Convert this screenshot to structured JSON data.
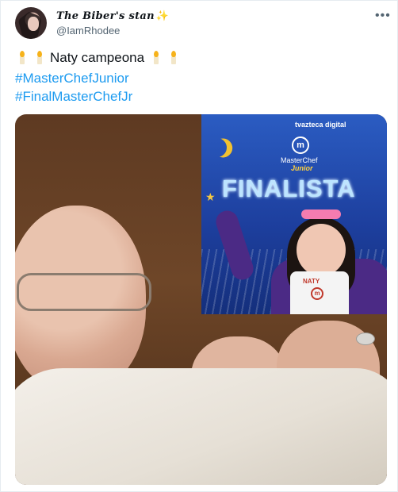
{
  "tweet": {
    "display_name": "The Biber's stan",
    "display_name_emoji": "✨",
    "handle": "@IamRhodee",
    "more_icon": "more-dots-icon",
    "text": "Naty campeona",
    "hashtags": [
      "#MasterChefJunior",
      "#FinalMasterChefJr"
    ]
  },
  "inset": {
    "channel": "tvazteca digital",
    "brand": "MasterChef",
    "brand_sub": "Junior",
    "headline": "FINALISTA",
    "apron_name": "NATY",
    "logo_letter": "m"
  },
  "colors": {
    "hashtag": "#1d9bf0",
    "handle": "#536471",
    "inset_bg": "#1d3f9e"
  }
}
